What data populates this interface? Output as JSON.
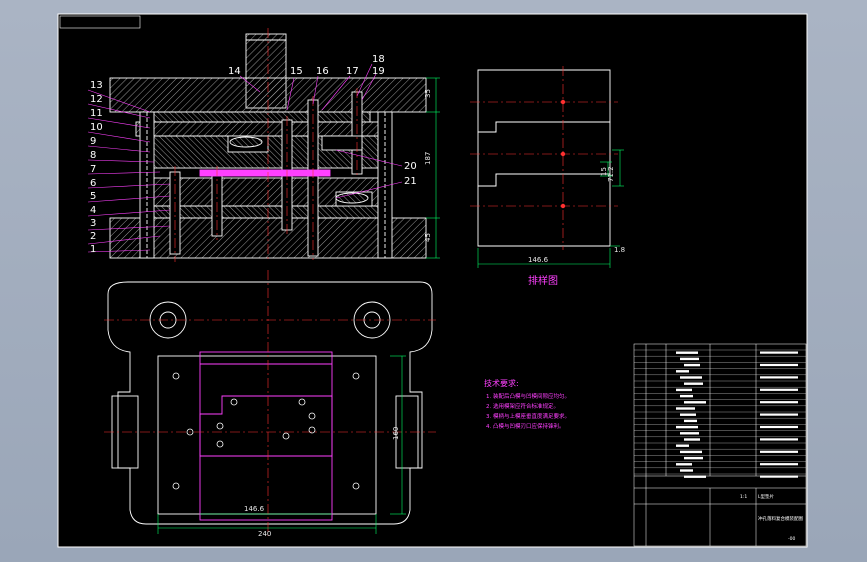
{
  "drawing": {
    "balloons": [
      "1",
      "2",
      "3",
      "4",
      "5",
      "6",
      "7",
      "8",
      "9",
      "10",
      "11",
      "12",
      "13",
      "14",
      "15",
      "16",
      "17",
      "18",
      "19",
      "20",
      "21"
    ],
    "dims": {
      "top_h": "35",
      "mid_h": "187",
      "bot_h": "45",
      "layout_gap": "15",
      "layout_h": "71.2",
      "layout_w": "146.6",
      "layout_tail": "1.8",
      "plan_inner_w": "146.6",
      "plan_outer_w": "240",
      "plan_h": "160"
    },
    "layout_title": "排样图",
    "notes": {
      "title": "技术要求:",
      "items": [
        "1. 装配后凸模与凹模间隙应均匀。",
        "2. 选用模架应符合标准规定。",
        "3. 模柄与上模座垂直度满足要求。",
        "4. 凸模与凹模刃口应保持锋利。"
      ]
    },
    "title_block": {
      "part_name_1": "L型垫片",
      "part_name_2": "冲孔落料复合模装配图",
      "scale": "1:1",
      "drawing_no": "-00"
    },
    "colors": {
      "outline": "#ffffff",
      "center": "#ff3030",
      "dimension": "#00ff66",
      "leader": "#ff40ff",
      "hatch": "#b0b0b0",
      "strip": "#ff40ff"
    }
  }
}
